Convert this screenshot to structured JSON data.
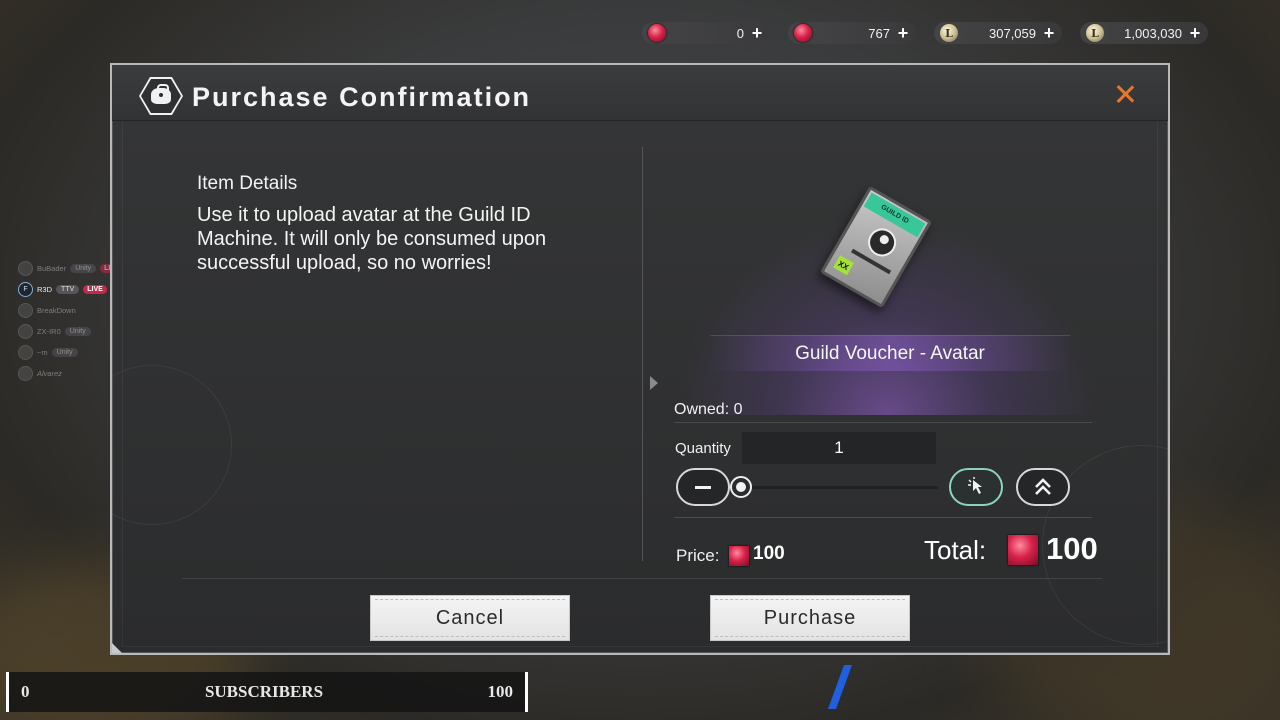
{
  "currencies": [
    {
      "icon": "red-gem-icon",
      "value": "0"
    },
    {
      "icon": "red-gem-icon",
      "value": "767"
    },
    {
      "icon": "gold-coin-icon",
      "value": "307,059"
    },
    {
      "icon": "gold-coin-icon",
      "value": "1,003,030"
    }
  ],
  "friends": [
    {
      "name": "BuBader",
      "platform": "Unity",
      "status": "LIVE"
    },
    {
      "name": "R3D",
      "platform": "TTV",
      "status": "LIVE",
      "avatar": "F"
    },
    {
      "name": "BreakDown",
      "platform": "",
      "status": ""
    },
    {
      "name": "ZX-IR0",
      "platform": "Unity",
      "status": ""
    },
    {
      "name": "~m",
      "platform": "Unity",
      "status": ""
    },
    {
      "name": "Alvarez",
      "platform": "",
      "status": ""
    }
  ],
  "dialog": {
    "title": "Purchase Confirmation",
    "details_title": "Item Details",
    "details_text": "Use it to upload avatar at the Guild ID Machine. It will only be consumed upon successful upload, so no worries!",
    "item_name": "Guild Voucher - Avatar",
    "card_band_text": "GUILD ID",
    "card_badge": "XX",
    "owned": "Owned: 0",
    "quantity_label": "Quantity",
    "quantity_value": "1",
    "quantity_fraction": 0,
    "price_label": "Price:",
    "price_value": "100",
    "total_label": "Total:",
    "total_value": "100",
    "cancel_label": "Cancel",
    "purchase_label": "Purchase",
    "accent_color": "#e8762d"
  },
  "subscribers": {
    "current": "0",
    "label": "SUBSCRIBERS",
    "goal": "100"
  }
}
